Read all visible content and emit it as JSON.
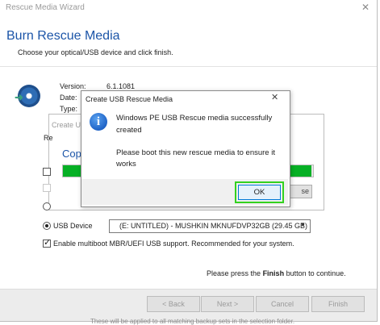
{
  "window": {
    "title": "Rescue Media Wizard",
    "close_glyph": "✕"
  },
  "header": {
    "title": "Burn Rescue Media",
    "subtitle": "Choose your optical/USB device and click finish."
  },
  "info": {
    "version_label": "Version:",
    "version_value": "6.1.1081",
    "date_label": "Date:",
    "type_label": "Type:",
    "icon": "disc-arrow-icon"
  },
  "copy_dialog": {
    "title": "Create U",
    "heading": "Copi",
    "progress": 1.0,
    "cancel_label": "se",
    "options_label": "Re"
  },
  "device": {
    "usb_label": "USB Device",
    "usb_selected": "(E: UNTITLED) - MUSHKIN MKNUFDVP32GB (29.45 GB)",
    "multiboot_label": "Enable multiboot MBR/UEFI USB support. Recommended for your system.",
    "multiboot_checked": true
  },
  "finish_note": {
    "prefix": "Please press the",
    "bold": "Finish",
    "suffix": "button to continue."
  },
  "buttons": {
    "back": "< Back",
    "next": "Next >",
    "cancel": "Cancel",
    "finish": "Finish"
  },
  "bottom_text": "These will be applied to all matching backup sets in the selection folder.",
  "message_box": {
    "title": "Create USB Rescue Media",
    "line1": "Windows PE USB Rescue media successfully",
    "line2": "created",
    "line3": "Please boot this new rescue media to ensure it",
    "line4": "works",
    "ok_label": "OK",
    "icon": "info-icon",
    "close_glyph": "✕"
  },
  "colors": {
    "accent": "#1c55a8",
    "progress": "#06b025",
    "highlight": "#33d11f"
  }
}
